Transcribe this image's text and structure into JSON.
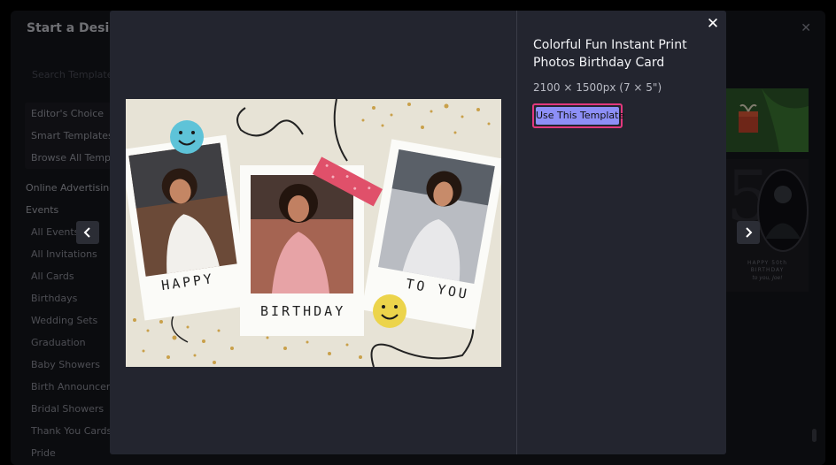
{
  "background": {
    "title": "Start a Design",
    "search_placeholder": "Search Templates",
    "menu": [
      "Editor's Choice",
      "Smart Templates",
      "Browse All Templates"
    ],
    "section_online": "Online Advertising",
    "section_events": "Events",
    "event_items": [
      "All Events",
      "All Invitations",
      "All Cards",
      "Birthdays",
      "Wedding Sets",
      "Graduation",
      "Baby Showers",
      "Birth Announcements",
      "Bridal Showers",
      "Thank You Cards",
      "Pride"
    ],
    "thumb_text_1": "HAPPY 50th",
    "thumb_text_2": "BIRTHDAY",
    "thumb_text_3": "to you, Joe!"
  },
  "modal": {
    "title": "Colorful Fun Instant Print Photos Birthday Card",
    "dimensions": "2100 × 1500px (7 × 5\")",
    "use_button": "Use This Template"
  },
  "card": {
    "photo1_caption": "HAPPY",
    "photo2_caption": "BIRTHDAY",
    "photo3_caption": "TO YOU"
  },
  "colors": {
    "accent": "#8d8ff7",
    "accent_border": "#e2387d",
    "modal_bg": "#23252f",
    "card_bg": "#e7e3d6"
  },
  "icons": {
    "close": "close-icon",
    "prev": "chevron-left-icon",
    "next": "chevron-right-icon"
  }
}
